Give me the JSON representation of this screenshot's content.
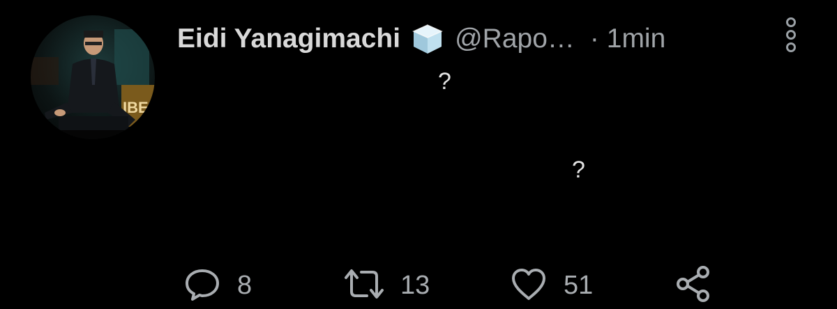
{
  "tweet": {
    "author": {
      "display_name": "Eidi Yanagimachi",
      "badge_icon": "ice-cube-icon",
      "handle": "@Rapo…",
      "separator": "·",
      "time": "1min"
    },
    "body": {
      "line1": "?",
      "line2": "?"
    },
    "actions": {
      "replies": "8",
      "retweets": "13",
      "likes": "51"
    },
    "colors": {
      "background": "#000000",
      "name": "#d9d9d9",
      "secondary": "#a0a4a8"
    }
  }
}
